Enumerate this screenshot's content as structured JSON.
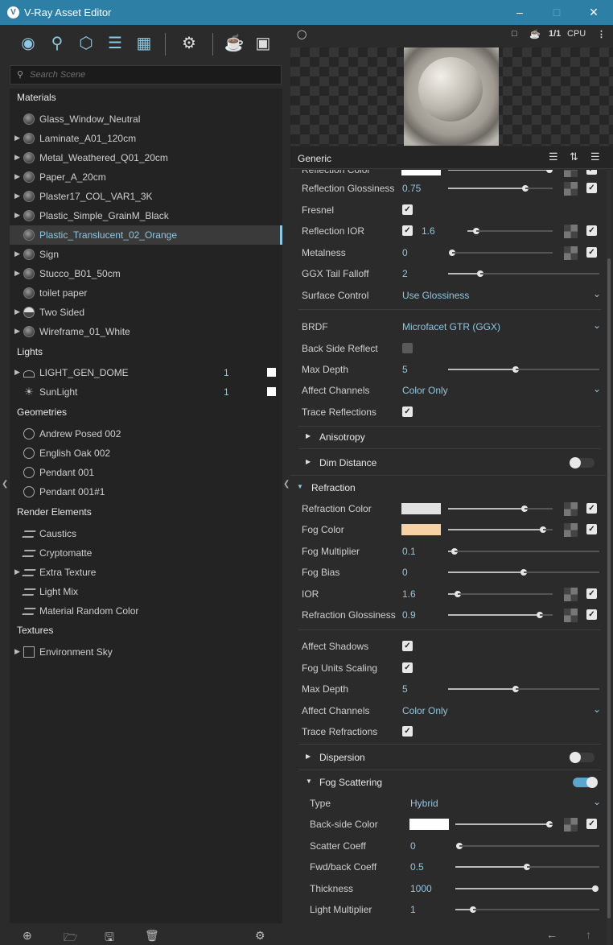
{
  "window": {
    "title": "V-Ray Asset Editor",
    "logo": "V"
  },
  "search": {
    "placeholder": "Search Scene"
  },
  "sections": {
    "materials": "Materials",
    "lights": "Lights",
    "geometries": "Geometries",
    "render_elements": "Render Elements",
    "textures": "Textures"
  },
  "materials": [
    {
      "label": "Glass_Window_Neutral",
      "expand": false
    },
    {
      "label": "Laminate_A01_120cm",
      "expand": true
    },
    {
      "label": "Metal_Weathered_Q01_20cm",
      "expand": true
    },
    {
      "label": "Paper_A_20cm",
      "expand": true
    },
    {
      "label": "Plaster17_COL_VAR1_3K",
      "expand": true
    },
    {
      "label": "Plastic_Simple_GrainM_Black",
      "expand": true
    },
    {
      "label": "Plastic_Translucent_02_Orange",
      "expand": false,
      "selected": true
    },
    {
      "label": "Sign",
      "expand": true
    },
    {
      "label": "Stucco_B01_50cm",
      "expand": true
    },
    {
      "label": "toilet paper",
      "expand": false
    },
    {
      "label": "Two Sided",
      "expand": true
    },
    {
      "label": "Wireframe_01_White",
      "expand": true
    }
  ],
  "lights": [
    {
      "label": "LIGHT_GEN_DOME",
      "count": "1",
      "icon": "dome-light-icon"
    },
    {
      "label": "SunLight",
      "count": "1",
      "icon": "sun-icon"
    }
  ],
  "geometries": [
    "Andrew Posed 002",
    "English Oak 002",
    "Pendant 001",
    "Pendant 001#1"
  ],
  "render_elements": [
    {
      "label": "Caustics",
      "expand": false
    },
    {
      "label": "Cryptomatte",
      "expand": false
    },
    {
      "label": "Extra Texture",
      "expand": true
    },
    {
      "label": "Light Mix",
      "expand": false
    },
    {
      "label": "Material Random Color",
      "expand": false
    }
  ],
  "textures": [
    "Environment Sky"
  ],
  "preview": {
    "ratio": "1/1",
    "engine": "CPU"
  },
  "panel": {
    "title": "Generic"
  },
  "props": {
    "refl_color": "Reflection Color",
    "refl_gloss": "Reflection Glossiness",
    "refl_gloss_v": "0.75",
    "fresnel": "Fresnel",
    "refl_ior": "Reflection IOR",
    "refl_ior_v": "1.6",
    "metalness": "Metalness",
    "metalness_v": "0",
    "ggx": "GGX Tail Falloff",
    "ggx_v": "2",
    "surface": "Surface Control",
    "surface_v": "Use Glossiness",
    "brdf": "BRDF",
    "brdf_v": "Microfacet GTR (GGX)",
    "backside": "Back Side Reflect",
    "maxdepth": "Max Depth",
    "maxdepth_v": "5",
    "affect": "Affect Channels",
    "affect_v": "Color Only",
    "trace_refl": "Trace Reflections",
    "anisotropy": "Anisotropy",
    "dim": "Dim Distance",
    "refraction": "Refraction",
    "refr_color": "Refraction Color",
    "fog_color": "Fog Color",
    "fog_mult": "Fog Multiplier",
    "fog_mult_v": "0.1",
    "fog_bias": "Fog Bias",
    "fog_bias_v": "0",
    "ior": "IOR",
    "ior_v": "1.6",
    "refr_gloss": "Refraction Glossiness",
    "refr_gloss_v": "0.9",
    "affect_shadows": "Affect Shadows",
    "fog_units": "Fog Units Scaling",
    "maxdepth2": "Max Depth",
    "maxdepth2_v": "5",
    "affect2": "Affect Channels",
    "affect2_v": "Color Only",
    "trace_refr": "Trace Refractions",
    "dispersion": "Dispersion",
    "fog_scatter": "Fog Scattering",
    "type": "Type",
    "type_v": "Hybrid",
    "backside_color": "Back-side Color",
    "scatter": "Scatter Coeff",
    "scatter_v": "0",
    "fwd": "Fwd/back Coeff",
    "fwd_v": "0.5",
    "thickness": "Thickness",
    "thickness_v": "1000",
    "light_mult": "Light Multiplier",
    "light_mult_v": "1"
  },
  "colors": {
    "accent": "#8fc6e0",
    "fog_color": "#f6d2a4",
    "refraction_color": "#e2e2e2",
    "titlebar": "#2d7fa6"
  }
}
